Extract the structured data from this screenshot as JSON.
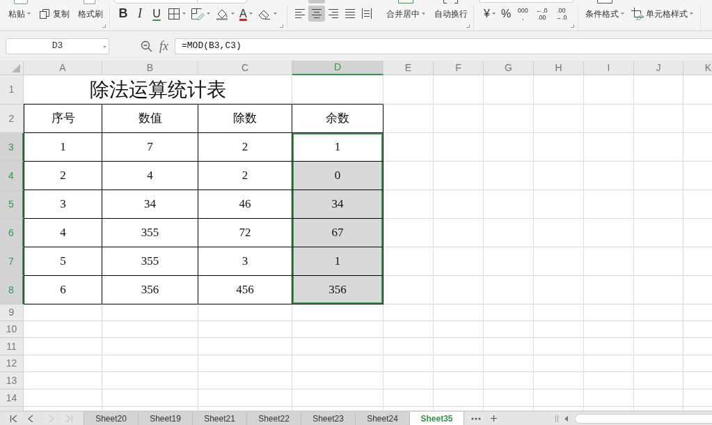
{
  "toolbar": {
    "clipboard": [
      {
        "kind": "plain",
        "label": "粘贴",
        "dropdown": true
      },
      {
        "kind": "copy",
        "label": "复制",
        "dropdown": false
      },
      {
        "kind": "plain",
        "label": "格式刷",
        "dropdown": false
      }
    ],
    "vertical_align": {
      "selected": true
    },
    "font": [
      {
        "kind": "bold",
        "label": "B",
        "dropdown": false
      },
      {
        "kind": "italic",
        "label": "I",
        "dropdown": false
      },
      {
        "kind": "underline",
        "label": "U",
        "dropdown": false
      },
      {
        "kind": "borders",
        "dropdown": true
      },
      {
        "kind": "cell_fill",
        "dropdown": true
      },
      {
        "kind": "fill_color",
        "dropdown": true
      },
      {
        "kind": "font_color",
        "label": "A",
        "dropdown": true
      },
      {
        "kind": "eraser",
        "dropdown": true
      }
    ],
    "align": [
      {
        "kind": "left",
        "selected": false
      },
      {
        "kind": "center",
        "selected": true
      },
      {
        "kind": "right",
        "selected": false
      },
      {
        "kind": "justify",
        "selected": false
      },
      {
        "kind": "distributed",
        "selected": false
      }
    ],
    "cell_layout": [
      {
        "label": "合并居中",
        "dropdown": true
      },
      {
        "label": "自动换行",
        "dropdown": false
      }
    ],
    "number": [
      {
        "kind": "text",
        "label": "¥",
        "dropdown": true
      },
      {
        "kind": "text",
        "label": "%",
        "dropdown": false
      },
      {
        "kind": "stack",
        "lines": [
          "000",
          ","
        ]
      },
      {
        "kind": "stack",
        "lines": [
          "←.0",
          ".00"
        ]
      },
      {
        "kind": "stack",
        "lines": [
          ".00",
          "→.0"
        ]
      }
    ],
    "styles": [
      {
        "kind": "plain",
        "label": "条件格式",
        "dropdown": true
      },
      {
        "kind": "cell_style",
        "label": "单元格样式",
        "dropdown": true
      }
    ]
  },
  "formula_bar": {
    "name_box": "D3",
    "function_label": "fx",
    "formula": "=MOD(B3,C3)"
  },
  "sheet": {
    "column_headers": [
      {
        "label": "A",
        "selected": false
      },
      {
        "label": "B",
        "selected": false
      },
      {
        "label": "C",
        "selected": false
      },
      {
        "label": "D",
        "selected": true
      },
      {
        "label": "E",
        "selected": false
      },
      {
        "label": "F",
        "selected": false
      },
      {
        "label": "G",
        "selected": false
      },
      {
        "label": "H",
        "selected": false
      },
      {
        "label": "I",
        "selected": false
      },
      {
        "label": "J",
        "selected": false
      },
      {
        "label": "K",
        "selected": false
      }
    ],
    "row_headers": [
      {
        "label": "1",
        "selected": false
      },
      {
        "label": "2",
        "selected": false
      },
      {
        "label": "3",
        "selected": true
      },
      {
        "label": "4",
        "selected": true
      },
      {
        "label": "5",
        "selected": true
      },
      {
        "label": "6",
        "selected": true
      },
      {
        "label": "7",
        "selected": true
      },
      {
        "label": "8",
        "selected": true
      },
      {
        "label": "9",
        "selected": false
      },
      {
        "label": "10",
        "selected": false
      },
      {
        "label": "11",
        "selected": false
      },
      {
        "label": "12",
        "selected": false
      },
      {
        "label": "13",
        "selected": false
      },
      {
        "label": "14",
        "selected": false
      }
    ],
    "title": "除法运算统计表",
    "table": [
      {
        "cells": [
          {
            "text": "序号",
            "selected": false,
            "active": false
          },
          {
            "text": "数值",
            "selected": false,
            "active": false
          },
          {
            "text": "除数",
            "selected": false,
            "active": false
          },
          {
            "text": "余数",
            "selected": false,
            "active": false
          }
        ]
      },
      {
        "cells": [
          {
            "text": "1",
            "selected": false,
            "active": false
          },
          {
            "text": "7",
            "selected": false,
            "active": false
          },
          {
            "text": "2",
            "selected": false,
            "active": false
          },
          {
            "text": "1",
            "selected": true,
            "active": true
          }
        ]
      },
      {
        "cells": [
          {
            "text": "2",
            "selected": false,
            "active": false
          },
          {
            "text": "4",
            "selected": false,
            "active": false
          },
          {
            "text": "2",
            "selected": false,
            "active": false
          },
          {
            "text": "0",
            "selected": true,
            "active": false
          }
        ]
      },
      {
        "cells": [
          {
            "text": "3",
            "selected": false,
            "active": false
          },
          {
            "text": "34",
            "selected": false,
            "active": false
          },
          {
            "text": "46",
            "selected": false,
            "active": false
          },
          {
            "text": "34",
            "selected": true,
            "active": false
          }
        ]
      },
      {
        "cells": [
          {
            "text": "4",
            "selected": false,
            "active": false
          },
          {
            "text": "355",
            "selected": false,
            "active": false
          },
          {
            "text": "72",
            "selected": false,
            "active": false
          },
          {
            "text": "67",
            "selected": true,
            "active": false
          }
        ]
      },
      {
        "cells": [
          {
            "text": "5",
            "selected": false,
            "active": false
          },
          {
            "text": "355",
            "selected": false,
            "active": false
          },
          {
            "text": "3",
            "selected": false,
            "active": false
          },
          {
            "text": "1",
            "selected": true,
            "active": false
          }
        ]
      },
      {
        "cells": [
          {
            "text": "6",
            "selected": false,
            "active": false
          },
          {
            "text": "356",
            "selected": false,
            "active": false
          },
          {
            "text": "456",
            "selected": false,
            "active": false
          },
          {
            "text": "356",
            "selected": true,
            "active": false
          }
        ]
      }
    ]
  },
  "sheet_tabs": {
    "nav": [
      {
        "kind": "first",
        "disabled": false
      },
      {
        "kind": "previous",
        "disabled": false
      },
      {
        "kind": "next",
        "disabled": true
      },
      {
        "kind": "last",
        "disabled": true
      }
    ],
    "tabs": [
      {
        "label": "Sheet20",
        "selected": false
      },
      {
        "label": "Sheet19",
        "selected": false
      },
      {
        "label": "Sheet21",
        "selected": false
      },
      {
        "label": "Sheet22",
        "selected": false
      },
      {
        "label": "Sheet23",
        "selected": false
      },
      {
        "label": "Sheet24",
        "selected": false
      },
      {
        "label": "Sheet35",
        "selected": true
      }
    ]
  }
}
